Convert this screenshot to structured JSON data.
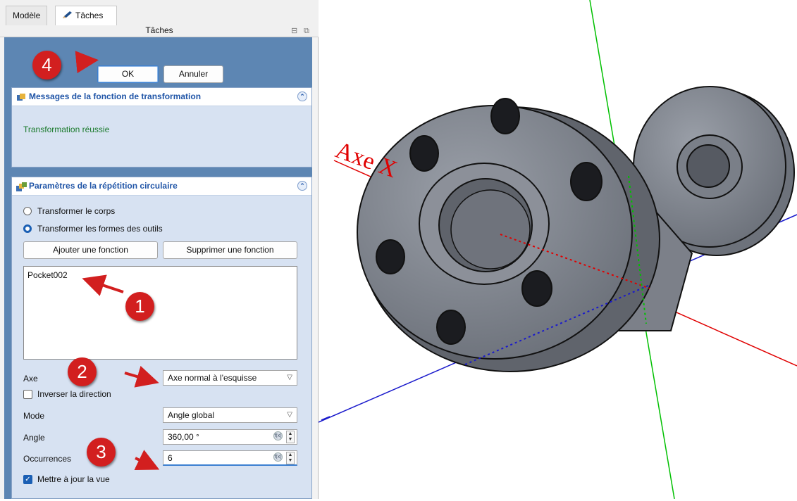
{
  "tabs": [
    {
      "label": "Modèle"
    },
    {
      "label": "Tâches"
    }
  ],
  "panel": {
    "title": "Tâches"
  },
  "buttons": {
    "ok": "OK",
    "cancel": "Annuler"
  },
  "messages": {
    "title": "Messages de la fonction de transformation",
    "text": "Transformation réussie"
  },
  "params": {
    "title": "Paramètres de la répétition circulaire",
    "radio_body": "Transformer le corps",
    "radio_tools": "Transformer les formes des outils",
    "add_feature": "Ajouter une fonction",
    "remove_feature": "Supprimer une fonction",
    "features": [
      "Pocket002"
    ],
    "axis_label": "Axe",
    "axis_value": "Axe normal à l'esquisse",
    "reverse_label": "Inverser la direction",
    "mode_label": "Mode",
    "mode_value": "Angle global",
    "angle_label": "Angle",
    "angle_value": "360,00 °",
    "occurrences_label": "Occurrences",
    "occurrences_value": "6",
    "update_label": "Mettre à jour la vue",
    "reverse_checked": false,
    "update_checked": true
  },
  "badges": {
    "b1": "1",
    "b2": "2",
    "b3": "3",
    "b4": "4"
  },
  "viewport": {
    "axis_label": "Axe X"
  },
  "colors": {
    "axis_x": "#e00000",
    "axis_y": "#00c000",
    "axis_z": "#1a1acc",
    "badge": "#d21f1f",
    "accent": "#2055a7"
  },
  "icons": [
    "pencil-icon",
    "box-icon",
    "polar-pattern-icon",
    "collapse-icon",
    "arrow-icon"
  ]
}
